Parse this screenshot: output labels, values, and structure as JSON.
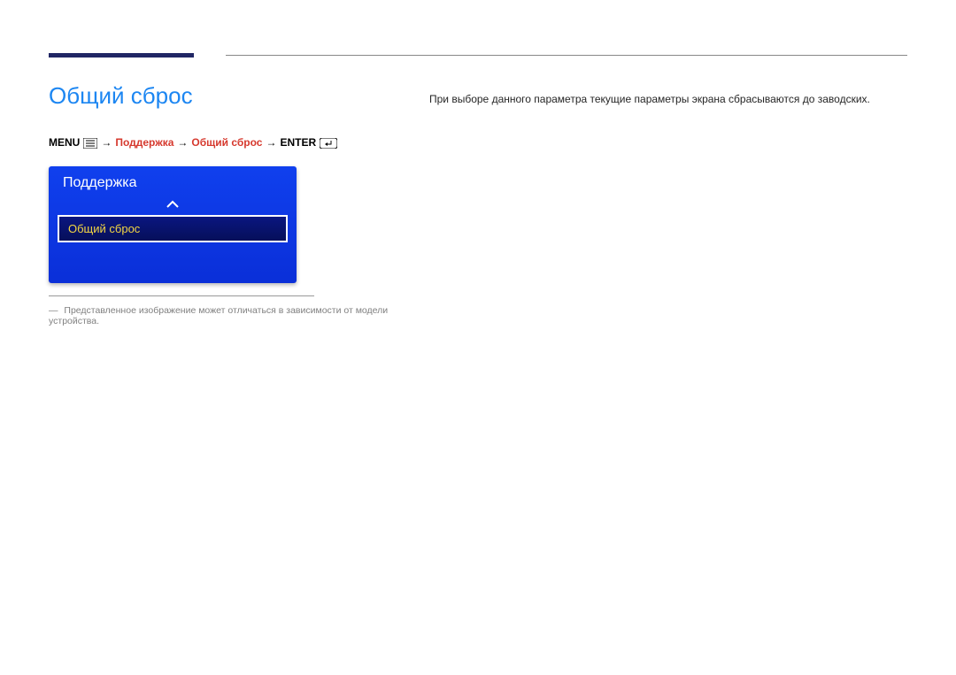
{
  "page": {
    "title": "Общий сброс"
  },
  "breadcrumb": {
    "menu_label": "MENU",
    "arrow": "→",
    "b1": "Поддержка",
    "b2": "Общий сброс",
    "enter_label": "ENTER"
  },
  "osd": {
    "title": "Поддержка",
    "item1": "Общий сброс"
  },
  "footnote": {
    "dash": "―",
    "text": "Представленное изображение может отличаться в зависимости от модели устройства."
  },
  "description": {
    "text": "При выборе данного параметра текущие параметры экрана сбрасываются до заводских."
  }
}
